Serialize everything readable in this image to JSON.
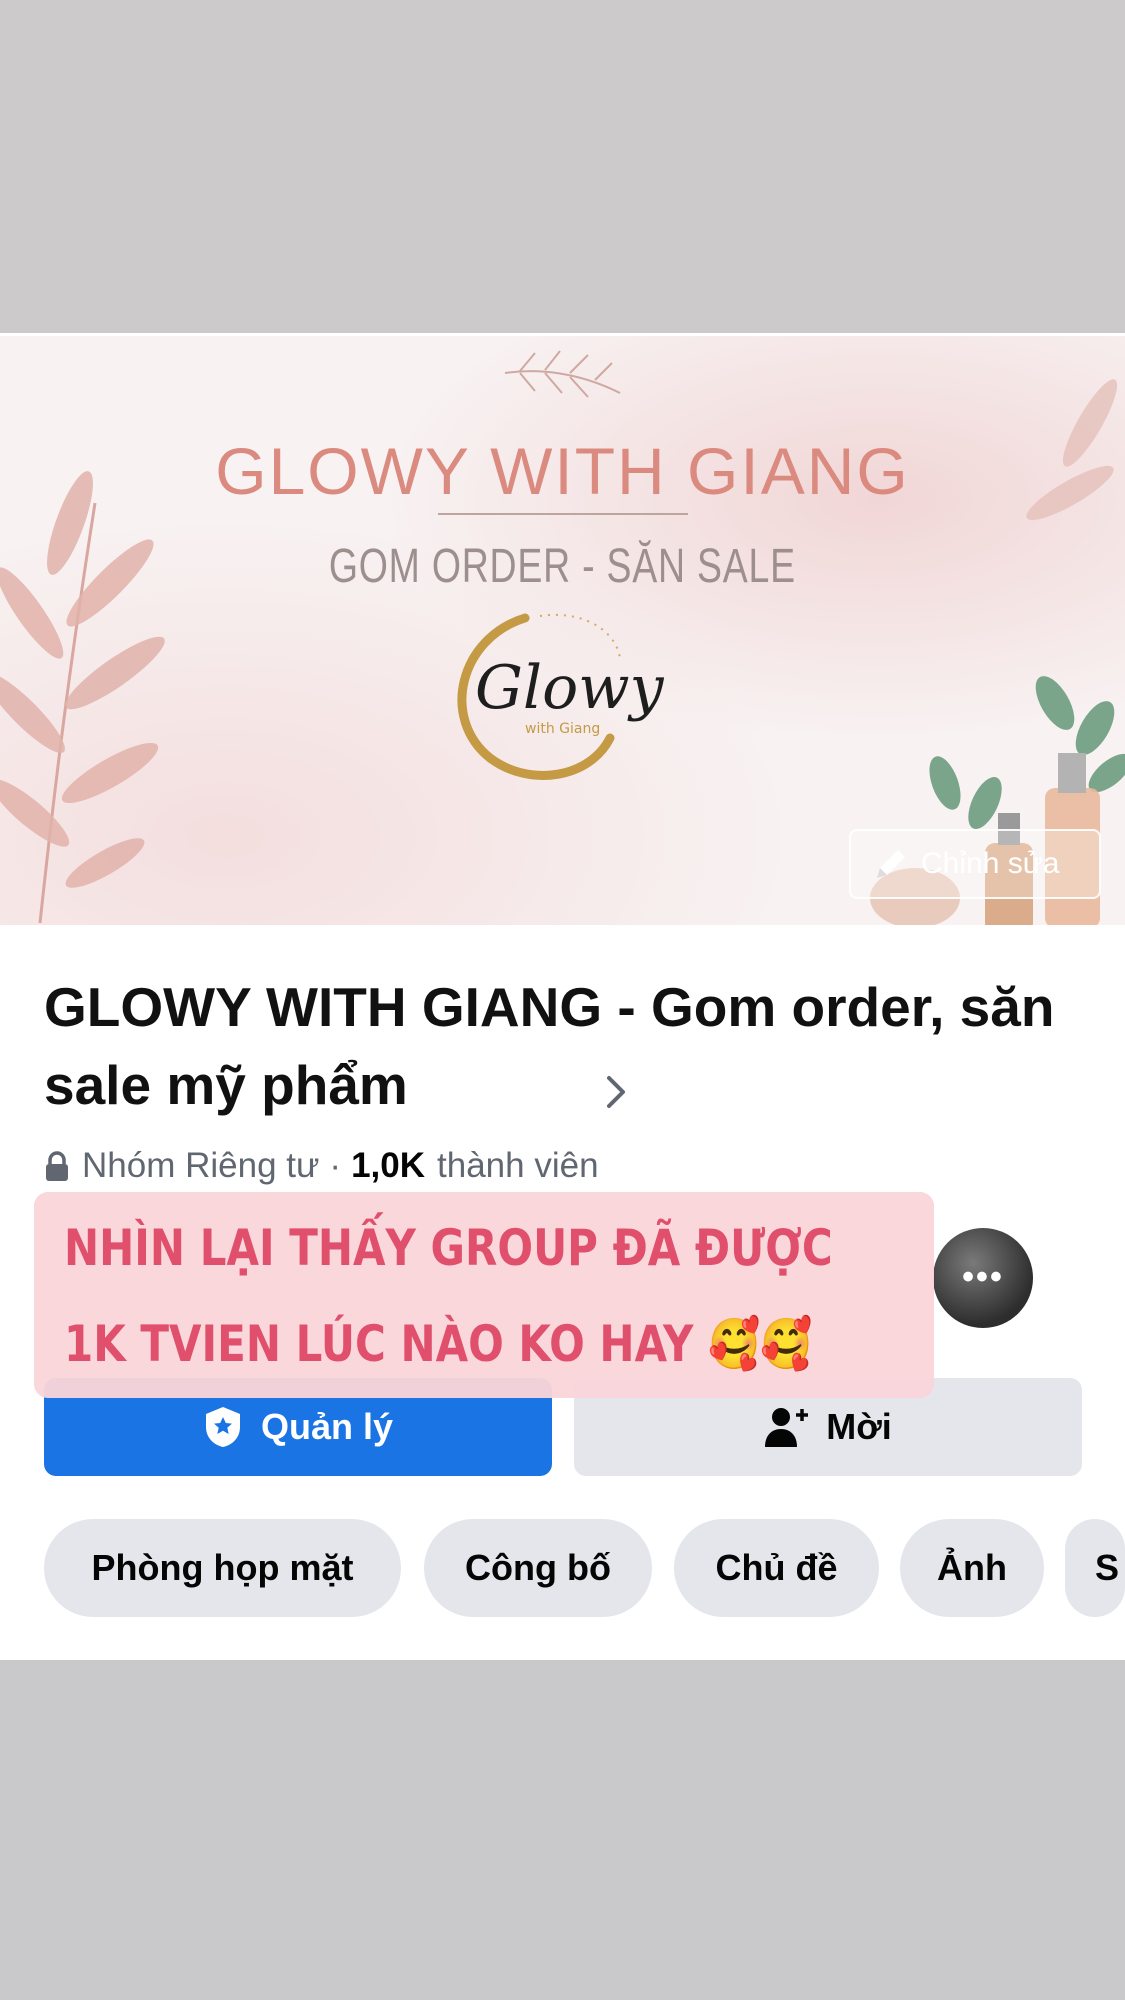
{
  "cover": {
    "title": "GLOWY WITH GIANG",
    "subtitle": "GOM ORDER - SĂN SALE",
    "logo_script": "Glowy",
    "logo_small": "with Giang",
    "edit_label": "Chỉnh sửa"
  },
  "group": {
    "name": "GLOWY WITH GIANG - Gom order, săn sale mỹ phẩm",
    "privacy": "Nhóm Riêng tư",
    "members_count": "1,0K",
    "members_label": "thành viên"
  },
  "actions": {
    "manage": "Quản lý",
    "invite": "Mời"
  },
  "tabs": [
    {
      "label": "Phòng họp mặt"
    },
    {
      "label": "Công bố"
    },
    {
      "label": "Chủ đề"
    },
    {
      "label": "Ảnh"
    },
    {
      "label": "S"
    }
  ],
  "story_caption": {
    "line1": "NHÌN LẠI THẤY GROUP ĐÃ ĐƯỢC",
    "line2": "1K TVIEN LÚC NÀO KO HAY 🥰🥰"
  },
  "colors": {
    "primary_blue": "#1b74e4",
    "caption_text": "#e04f6c",
    "caption_bg": "#f9d5da",
    "cover_title": "#db8a80"
  }
}
